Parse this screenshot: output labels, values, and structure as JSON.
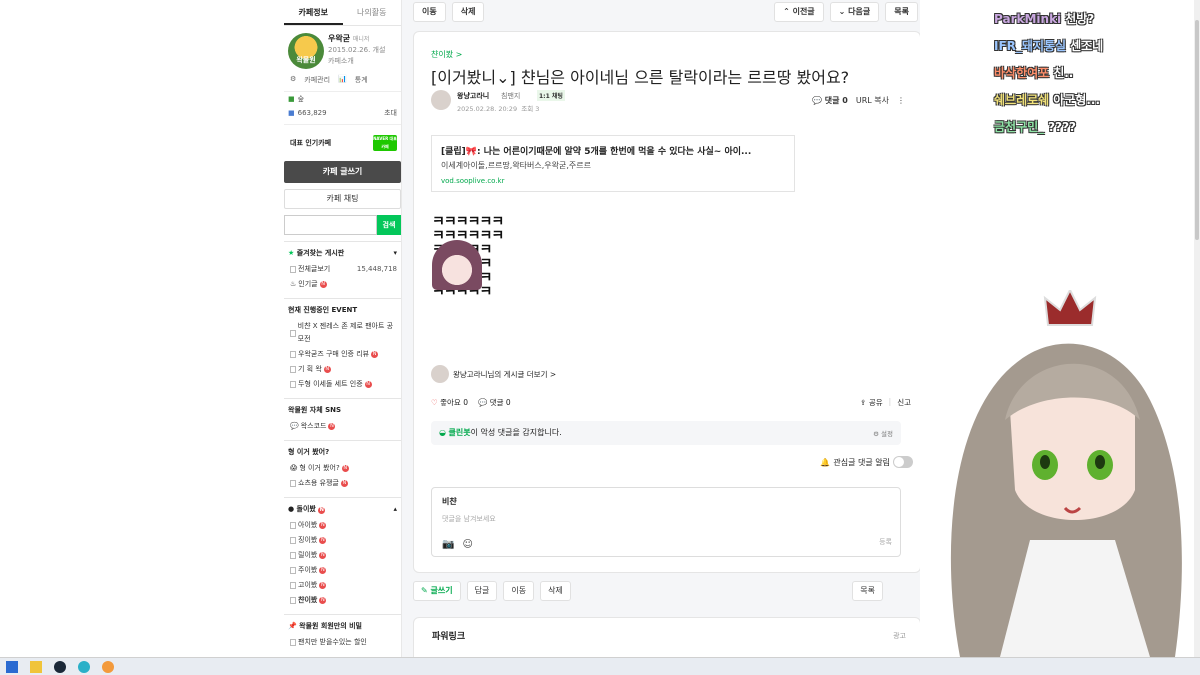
{
  "sidebar": {
    "tabs": [
      "카페정보",
      "나의활동"
    ],
    "cafe": {
      "avatar_text": "왁물원",
      "nick": "우왁굳",
      "role": "매니저",
      "date": "2015.02.26. 개설",
      "intro": "카페소개"
    },
    "links": [
      "카페관리",
      "통계"
    ],
    "level_label": "숲",
    "members": "663,829",
    "invite": "초대",
    "rep_label": "대표 인기카페",
    "naver_badge": "NAVER 대표카페",
    "write_btn": "카페 글쓰기",
    "chat_btn": "카페 채팅",
    "search_btn": "검색",
    "fav_title": "즐겨찾는 게시판",
    "all_posts": "전체글보기",
    "all_posts_count": "15,448,718",
    "popular": "인기글",
    "event_title": "현재 진행중인 EVENT",
    "events": [
      "비챤 X 젠레스 존 제로 팬아트 공모전",
      "우왁굳즈 구매 인증 리뷰",
      "기 획 왁",
      "두형 이세돌 세트 인증"
    ],
    "sns_title": "왁물원 자체 SNS",
    "sns_items": [
      "왁스코드"
    ],
    "hyung_title": "형 이거 봤어?",
    "hyung_items": [
      "형 이거 봤어?",
      "쇼츠용 유쟁글"
    ],
    "doli_title": "돌이봤",
    "doli_items": [
      "아이봤",
      "징이봤",
      "릴이봤",
      "주이봤",
      "고이봤",
      "챤이봤"
    ],
    "secret_title": "왁물원 회원만의 비밀",
    "secret_items": [
      "팬치만 받을수있는 할인"
    ]
  },
  "topbar": {
    "move": "이동",
    "delete": "삭제",
    "prev": "이전글",
    "next": "다음글",
    "list": "목록"
  },
  "article": {
    "board": "챤이봤 >",
    "title": "[이거봤니⌄] 챤님은 아이네님 으른 탈락이라는 르르땅 봤어요?",
    "author": "왕냥고라니",
    "rank": "침팬지",
    "chat_badge": "1:1 채팅",
    "date": "2025.02.28. 20:29",
    "views": "조회 3",
    "comments": "댓글 0",
    "url_copy": "URL 복사",
    "link_title": "[클립]🎀: 나는 어른이기때문에 알약 5개를 한번에 먹을 수 있다는 사실~ 아이...",
    "link_desc": "이세계아이돌,르르땅,왁타버스,우왁굳,주르르",
    "link_url": "vod.sooplive.co.kr",
    "sticker_text": "ㅋㅋㅋㅋㅋㅋ\nㅋㅋㅋㅋㅋㅋ\nㅋㅋㅋㅋㅋ\nㅋㅋㅋㅋㅋ\nㅋㅋㅋㅋㅋ\nㅋㅋㅋㅋㅋ",
    "more_posts": "왕냥고라니님의 게시글 더보기 >",
    "like": "좋아요 0",
    "comment": "댓글 0",
    "share": "공유",
    "report": "신고",
    "cleanbot_name": "클린봇",
    "cleanbot_text": "이 악성 댓글을 감지합니다.",
    "cleanbot_setting": "설정",
    "watch_label": "관심글 댓글 알림",
    "comment_user": "비챤",
    "comment_placeholder": "댓글을 남겨보세요",
    "submit": "등록"
  },
  "bottombar": {
    "write": "글쓰기",
    "reply": "답글",
    "move": "이동",
    "delete": "삭제",
    "list": "목록"
  },
  "powerlink": {
    "title": "파워링크",
    "right": "광고"
  },
  "chat": [
    {
      "user": "ParkMinki",
      "msg": "천방?",
      "color": "#c9a7e0"
    },
    {
      "user": "IFR_돼지통실",
      "msg": "센조네",
      "color": "#9bc6ff"
    },
    {
      "user": "바삭한여포",
      "msg": "친..",
      "color": "#ff8f6b"
    },
    {
      "user": "쉐브레로쉐",
      "msg": "아군형...",
      "color": "#f2e27a"
    },
    {
      "user": "금천구민_",
      "msg": "????",
      "color": "#8fe3a6"
    }
  ]
}
